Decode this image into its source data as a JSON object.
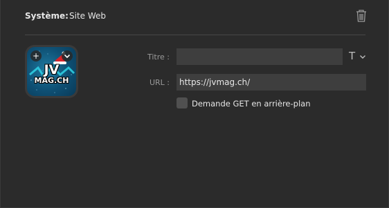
{
  "header": {
    "system_label": "Système:",
    "system_value": "Site Web"
  },
  "icons": {
    "trash": "trash-icon",
    "add": "plus-icon",
    "menu": "chevron-down-icon",
    "font": "text-format-icon"
  },
  "tile": {
    "logo_line1": "JV",
    "logo_line2": "MAG.CH",
    "add_label": "+"
  },
  "form": {
    "title_label": "Titre :",
    "title_value": "",
    "url_label": "URL :",
    "url_value": "https://jvmag.ch/",
    "font_glyph": "T",
    "background_get_label": "Demande GET en arrière-plan",
    "background_get_checked": false
  },
  "colors": {
    "background": "#2b2b2b",
    "field": "#3e3e3e",
    "tile_blue": "#0e4f73"
  }
}
